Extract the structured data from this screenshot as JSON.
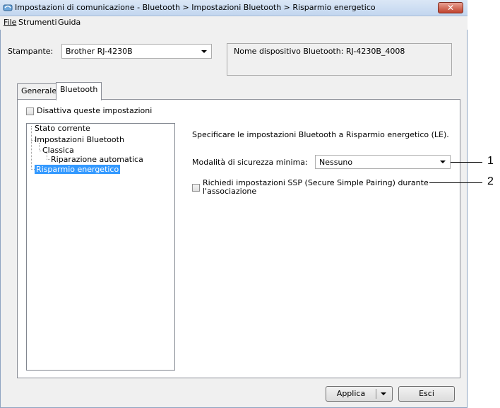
{
  "window": {
    "title": "Impostazioni di comunicazione - Bluetooth > Impostazioni Bluetooth > Risparmio energetico",
    "close_label": "✕"
  },
  "menu": {
    "file": "File",
    "tools": "Strumenti",
    "help": "Guida"
  },
  "printer": {
    "label": "Stampante:",
    "selected": "Brother RJ-4230B",
    "device_name": "Nome dispositivo Bluetooth: RJ-4230B_4008"
  },
  "tabs": [
    {
      "label": "Generale",
      "active": false
    },
    {
      "label": "Bluetooth",
      "active": true
    }
  ],
  "disable_settings": {
    "label": "Disattiva queste impostazioni",
    "checked": false
  },
  "tree": {
    "items": [
      {
        "label": "Stato corrente",
        "selected": false
      },
      {
        "label": "Impostazioni Bluetooth",
        "selected": false
      },
      {
        "label": "Classica",
        "selected": false
      },
      {
        "label": "Riparazione automatica",
        "selected": false
      },
      {
        "label": "Risparmio energetico",
        "selected": true
      }
    ]
  },
  "panel": {
    "description": "Specificare le impostazioni Bluetooth a Risparmio energetico (LE).",
    "security_label": "Modalità di sicurezza minima:",
    "security_value": "Nessuno",
    "ssp_label_line1": "Richiedi impostazioni SSP (Secure Simple Pairing) durante",
    "ssp_label_line2": "l'associazione",
    "ssp_checked": false
  },
  "buttons": {
    "apply": "Applica",
    "exit": "Esci"
  },
  "callouts": [
    "1",
    "2"
  ],
  "colors": {
    "selection": "#3399ff",
    "titlebar": "#c2d6ef",
    "close": "#c0432d"
  }
}
